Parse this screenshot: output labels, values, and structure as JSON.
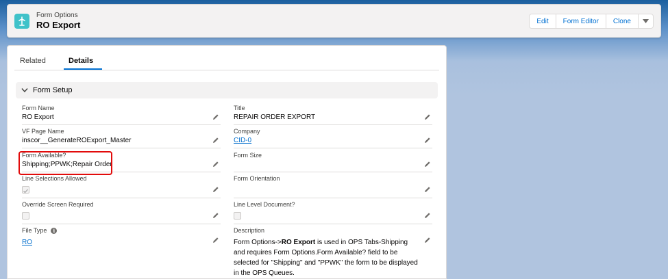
{
  "header": {
    "eyebrow": "Form Options",
    "title": "RO Export",
    "buttons": {
      "edit": "Edit",
      "form_editor": "Form Editor",
      "clone": "Clone"
    },
    "icon_color": "#3fc2c9"
  },
  "tabs": {
    "related": "Related",
    "details": "Details"
  },
  "section": {
    "title": "Form Setup"
  },
  "left_fields": {
    "form_name": {
      "label": "Form Name",
      "value": "RO Export"
    },
    "vf_page_name": {
      "label": "VF Page Name",
      "value": "inscor__GenerateROExport_Master"
    },
    "form_available": {
      "label": "Form Available?",
      "value": "Shipping;PPWK;Repair Order"
    },
    "line_selections": {
      "label": "Line Selections Allowed",
      "checked": true
    },
    "override_screen": {
      "label": "Override Screen Required",
      "checked": false
    },
    "file_type": {
      "label": "File Type",
      "value": "RO"
    }
  },
  "right_fields": {
    "title": {
      "label": "Title",
      "value": "REPAIR ORDER EXPORT"
    },
    "company": {
      "label": "Company",
      "value": "CID-0"
    },
    "form_size": {
      "label": "Form Size",
      "value": ""
    },
    "form_orientation": {
      "label": "Form Orientation",
      "value": ""
    },
    "line_level_document": {
      "label": "Line Level Document?",
      "checked": false
    },
    "description": {
      "label": "Description",
      "prefix": "Form Options->",
      "bold": "RO Export",
      "suffix": " is used in OPS Tabs-Shipping and requires Form Options.Form Available? field to be selected for \"Shipping\" and \"PPWK\" the form to be displayed in the OPS Queues."
    }
  },
  "colors": {
    "link": "#006dcc",
    "highlight": "#e20b0b",
    "accent": "#0070d2"
  }
}
